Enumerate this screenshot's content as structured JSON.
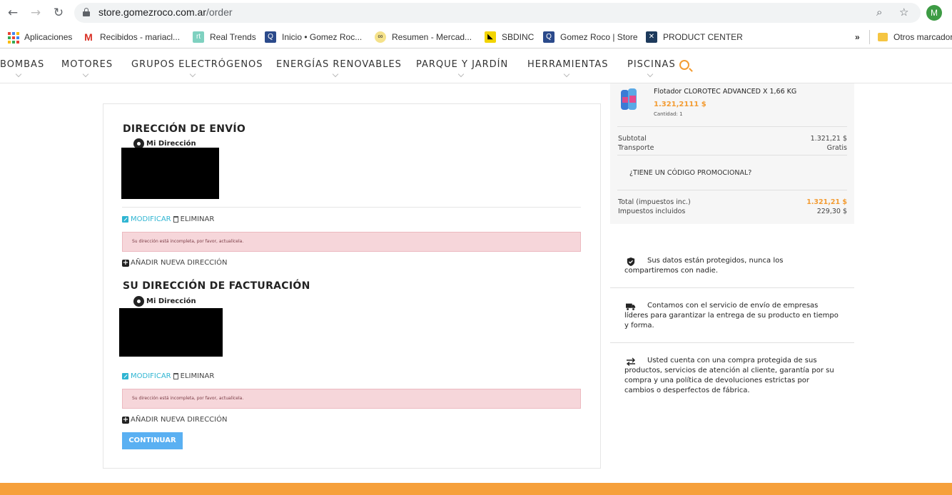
{
  "browser": {
    "url_host": "store.gomezroco.com.ar",
    "url_path": "/order",
    "profile_initial": "M",
    "bookmarks": [
      {
        "label": "Aplicaciones",
        "icon": "apps-grid-icon"
      },
      {
        "label": "Recibidos - mariacl...",
        "icon": "gmail-icon"
      },
      {
        "label": "Real Trends",
        "icon": "realtrends-icon"
      },
      {
        "label": "Inicio • Gomez Roc...",
        "icon": "gomezroco-icon"
      },
      {
        "label": "Resumen - Mercad...",
        "icon": "mercado-icon"
      },
      {
        "label": "SBDINC",
        "icon": "sbdinc-icon"
      },
      {
        "label": "Gomez Roco | Store",
        "icon": "gomezroco-icon"
      },
      {
        "label": "PRODUCT CENTER",
        "icon": "productcenter-icon"
      }
    ],
    "more_bookmarks": "»",
    "other_bookmarks": "Otros marcador"
  },
  "nav": {
    "items": [
      "BOMBAS",
      "MOTORES",
      "GRUPOS ELECTRÓGENOS",
      "ENERGÍAS RENOVABLES",
      "PARQUE Y JARDÍN",
      "HERRAMIENTAS",
      "PISCINAS"
    ]
  },
  "shipping": {
    "title": "DIRECCIÓN DE ENVÍO",
    "address_alias": "Mi Dirección",
    "edit_label": "MODIFICAR",
    "delete_label": "ELIMINAR",
    "alert": "Su dirección está incompleta, por favor, actualícela.",
    "add_label": "AÑADIR NUEVA DIRECCIÓN"
  },
  "billing": {
    "title": "SU DIRECCIÓN DE FACTURACIÓN",
    "address_alias": "Mi Dirección",
    "edit_label": "MODIFICAR",
    "delete_label": "ELIMINAR",
    "alert": "Su dirección está incompleta, por favor, actualícela.",
    "add_label": "AÑADIR NUEVA DIRECCIÓN"
  },
  "continue_label": "CONTINUAR",
  "summary": {
    "product_name": "Flotador CLOROTEC ADVANCED X 1,66 KG",
    "product_price": "1.321,2111 $",
    "product_qty": "Cantidad: 1",
    "subtotal_label": "Subtotal",
    "subtotal_value": "1.321,21 $",
    "shipping_label": "Transporte",
    "shipping_value": "Gratis",
    "promo_label": "¿TIENE UN CÓDIGO PROMOCIONAL?",
    "total_label": "Total (impuestos inc.)",
    "total_value": "1.321,21 $",
    "taxes_label": "Impuestos incluidos",
    "taxes_value": "229,30 $"
  },
  "reassurance": [
    {
      "icon": "shield-icon",
      "text": "Sus datos están protegidos, nunca los compartiremos con nadie."
    },
    {
      "icon": "truck-icon",
      "text": "Contamos con el servicio de envío de empresas líderes para garantizar la entrega de su producto en tiempo y forma."
    },
    {
      "icon": "exchange-icon",
      "text": "Usted cuenta con una compra protegida de sus productos, servicios de atención al cliente, garantía por su compra y una política de devoluciones estrictas por cambios o desperfectos de fábrica."
    }
  ],
  "colors": {
    "accent": "#f39c33",
    "link": "#2fb5d2",
    "button": "#5ab0f2",
    "footer": "#f6a03b"
  }
}
